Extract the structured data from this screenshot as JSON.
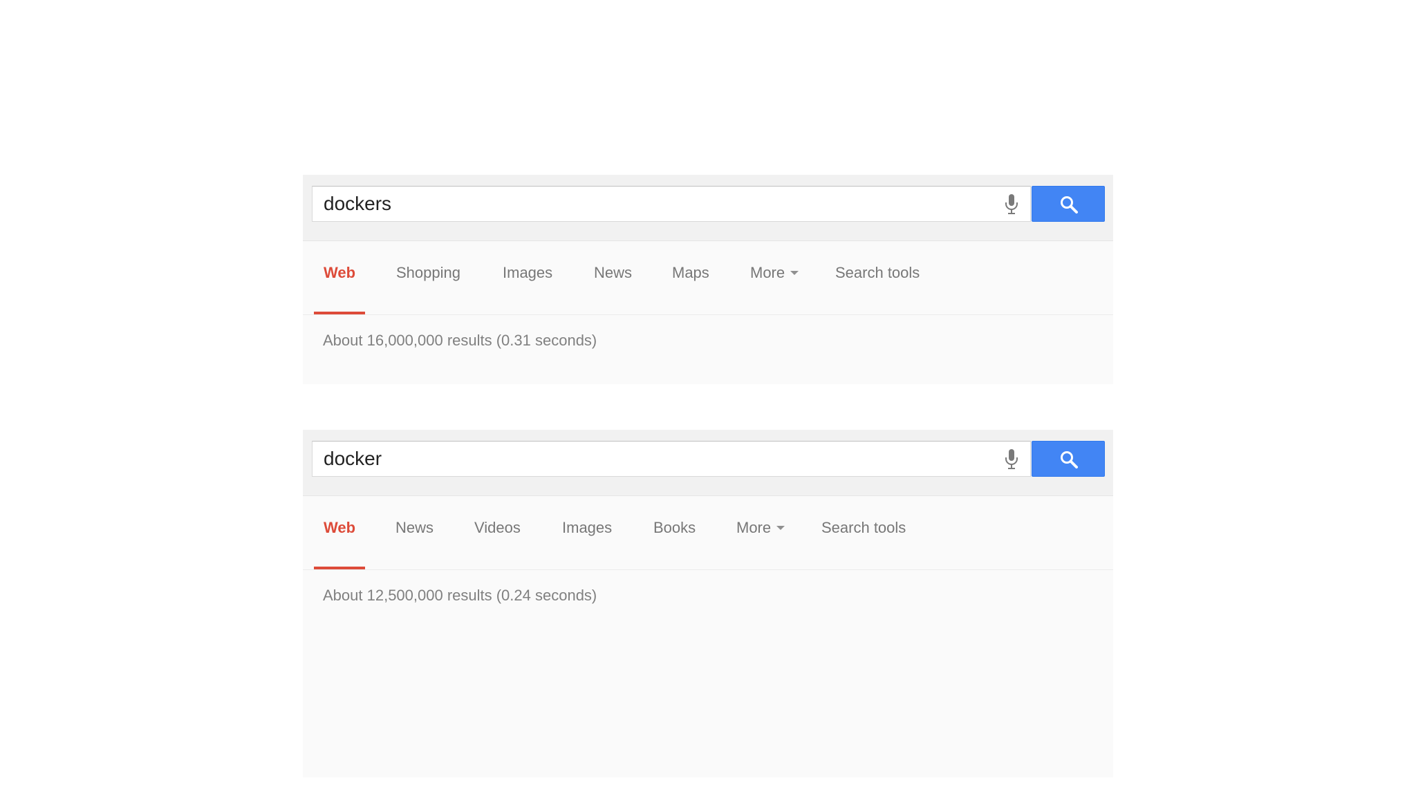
{
  "panels": [
    {
      "query": "dockers",
      "tabs": [
        "Web",
        "Shopping",
        "Images",
        "News",
        "Maps",
        "More",
        "Search tools"
      ],
      "active_tab": "Web",
      "result_stats": "About 16,000,000 results (0.31 seconds)"
    },
    {
      "query": "docker",
      "tabs": [
        "Web",
        "News",
        "Videos",
        "Images",
        "Books",
        "More",
        "Search tools"
      ],
      "active_tab": "Web",
      "result_stats": "About 12,500,000 results (0.24 seconds)"
    }
  ],
  "icons": {
    "mic": "microphone-icon",
    "search": "magnifier-icon",
    "more_caret": "caret-down-icon"
  },
  "colors": {
    "active_tab": "#dd4b39",
    "search_button": "#4285f4",
    "tab_text": "#777777",
    "stats_text": "#808080"
  }
}
